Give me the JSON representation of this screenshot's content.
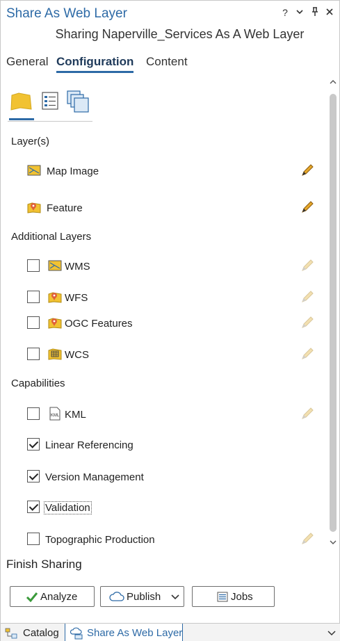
{
  "window": {
    "title": "Share As Web Layer",
    "controls": {
      "help": "?",
      "menu": "⌄",
      "pin": "📌",
      "close": "✕"
    }
  },
  "subtitle": "Sharing Naperville_Services As A Web Layer",
  "tabs": [
    {
      "label": "General",
      "active": false
    },
    {
      "label": "Configuration",
      "active": true
    },
    {
      "label": "Content",
      "active": false
    }
  ],
  "subtabs": [
    "configure-layers-icon",
    "properties-icon",
    "pages-icon"
  ],
  "layers": {
    "heading": "Layer(s)",
    "items": [
      {
        "label": "Map Image",
        "icon": "map-image-icon"
      },
      {
        "label": "Feature",
        "icon": "feature-layer-icon"
      }
    ]
  },
  "additional_layers": {
    "heading": "Additional Layers",
    "items": [
      {
        "label": "WMS",
        "checked": false,
        "icon": "map-image-icon"
      },
      {
        "label": "WFS",
        "checked": false,
        "icon": "feature-layer-icon"
      },
      {
        "label": "OGC Features",
        "checked": false,
        "icon": "feature-layer-icon"
      },
      {
        "label": "WCS",
        "checked": false,
        "icon": "raster-icon"
      }
    ]
  },
  "capabilities": {
    "heading": "Capabilities",
    "items": [
      {
        "label": "KML",
        "checked": false,
        "icon": "kml-icon"
      },
      {
        "label": "Linear Referencing",
        "checked": true
      },
      {
        "label": "Version Management",
        "checked": true
      },
      {
        "label": "Validation",
        "checked": true
      },
      {
        "label": "Topographic Production",
        "checked": false
      }
    ]
  },
  "finish": {
    "heading": "Finish Sharing",
    "analyze_label": "Analyze",
    "publish_label": "Publish",
    "jobs_label": "Jobs"
  },
  "bottom_tabs": [
    {
      "label": "Catalog",
      "active": false
    },
    {
      "label": "Share As Web Layer",
      "active": true
    }
  ],
  "colors": {
    "accent": "#2d6aa6",
    "analyze_check": "#3a9a3a",
    "pencil": "#d49a1e"
  }
}
